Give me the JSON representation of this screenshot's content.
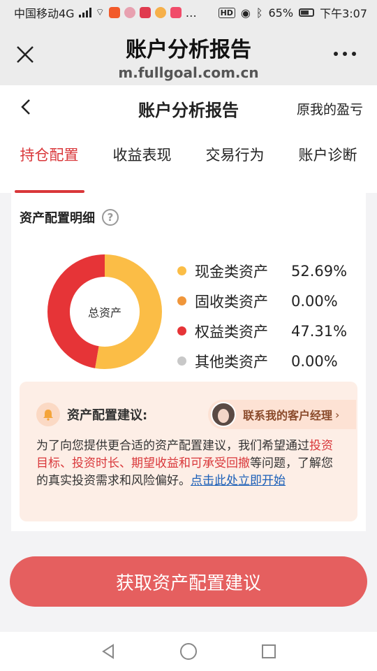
{
  "status_bar": {
    "carrier": "中国移动4G",
    "battery": "65%",
    "time": "下午3:07",
    "hd": "HD"
  },
  "browser": {
    "title": "账户分析报告",
    "url": "m.fullgoal.com.cn",
    "close_icon": "close-icon",
    "more_icon": "more-icon"
  },
  "page": {
    "title": "账户分析报告",
    "right_label": "原我的盈亏"
  },
  "tabs": [
    {
      "label": "持仓配置",
      "active": true
    },
    {
      "label": "收益表现",
      "active": false
    },
    {
      "label": "交易行为",
      "active": false
    },
    {
      "label": "账户诊断",
      "active": false
    }
  ],
  "allocation": {
    "title": "资产配置明细",
    "help_icon": "?",
    "center_label": "总资产",
    "items": [
      {
        "name": "现金类资产",
        "value": "52.69%",
        "color": "#fbbd46",
        "share": 52.69
      },
      {
        "name": "固收类资产",
        "value": "0.00%",
        "color": "#f0963a",
        "share": 0
      },
      {
        "name": "权益类资产",
        "value": "47.31%",
        "color": "#e63437",
        "share": 47.31
      },
      {
        "name": "其他类资产",
        "value": "0.00%",
        "color": "#c8c8c8",
        "share": 0
      }
    ]
  },
  "advice": {
    "title": "资产配置建议:",
    "contact": "联系我的客户经理",
    "body_1": "为了向您提供更合适的资产配置建议，我们希望通过",
    "body_hl": "投资目标、投资时长、期望收益和可承受回撤",
    "body_2": "等问题，了解您的真实投资需求和风险偏好。",
    "link": "点击此处立即开始"
  },
  "cta": {
    "label": "获取资产配置建议"
  },
  "colors": {
    "accent": "#d9373a",
    "cta": "#e55f5f",
    "link": "#1b5fb8"
  }
}
